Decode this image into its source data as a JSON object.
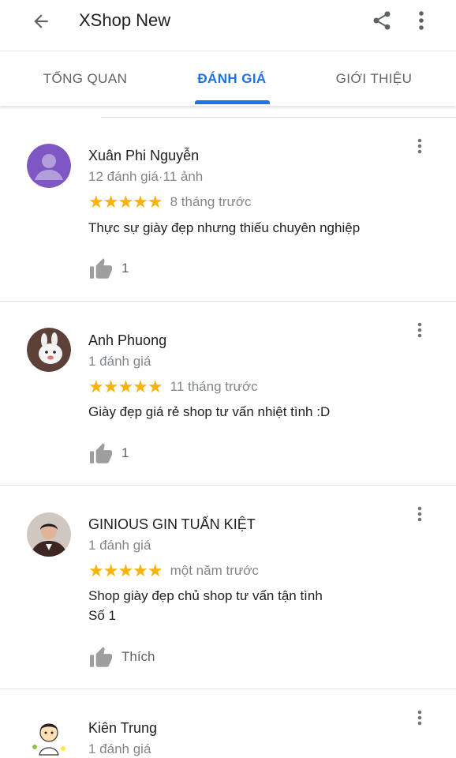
{
  "appbar": {
    "title": "XShop New",
    "back_icon": "arrow-back-icon",
    "share_icon": "share-icon",
    "more_icon": "more-vert-icon"
  },
  "tabs": [
    {
      "label": "TỔNG QUAN",
      "active": false
    },
    {
      "label": "ĐÁNH GIÁ",
      "active": true
    },
    {
      "label": "GIỚI THIỆU",
      "active": false
    }
  ],
  "colors": {
    "accent": "#1a73e8",
    "star": "#f9b208",
    "secondary_text": "#80868b"
  },
  "reviews": [
    {
      "name": "Xuân Phi Nguyễn",
      "meta": "12 đánh giá·11 ảnh",
      "stars": "★★★★★",
      "rating": 5,
      "time": "8 tháng trước",
      "text": "Thực sự giày đẹp nhưng thiếu chuyên nghiệp",
      "likes": "1"
    },
    {
      "name": "Anh Phuong",
      "meta": "1 đánh giá",
      "stars": "★★★★★",
      "rating": 5,
      "time": "11 tháng trước",
      "text": "Giày đẹp giá rẻ shop tư vấn nhiệt tình :D",
      "likes": "1"
    },
    {
      "name": "GINIOUS GIN TUẤN KIỆT",
      "meta": "1 đánh giá",
      "stars": "★★★★★",
      "rating": 5,
      "time": "một năm trước",
      "text_line1": "Shop giày đẹp chủ shop tư vấn tận tình",
      "text_line2": "Số 1",
      "likes": "Thích"
    },
    {
      "name": "Kiên Trung",
      "meta": "1 đánh giá"
    }
  ]
}
